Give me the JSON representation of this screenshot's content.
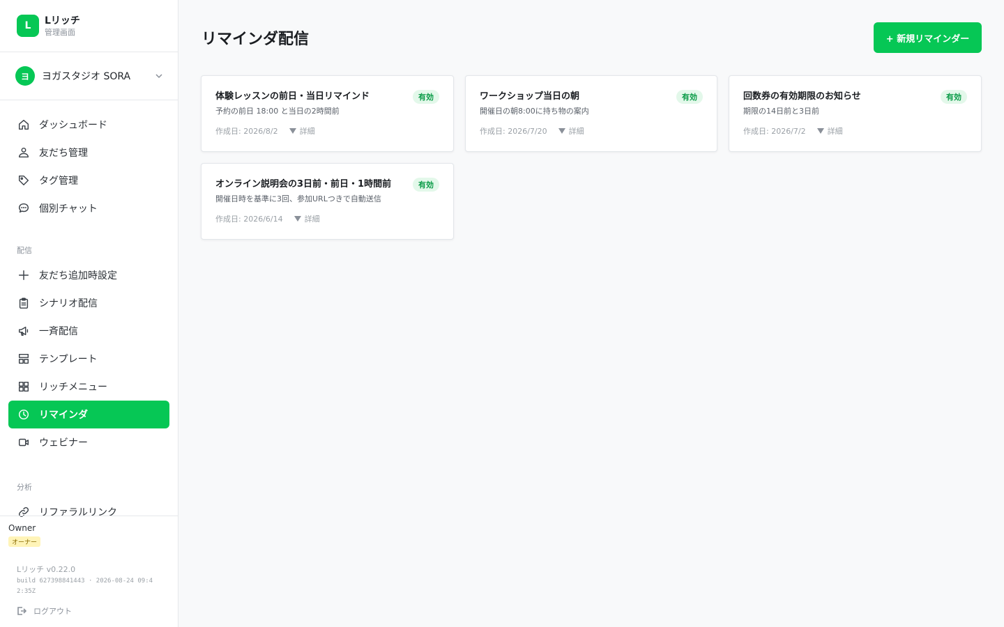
{
  "brand": {
    "logo": "L",
    "name": "Lリッチ",
    "subtitle": "管理画面",
    "color": "#06c755"
  },
  "account": {
    "avatar": "ヨ",
    "name": "ヨガスタジオ SORA",
    "icon": "chevron-down-icon"
  },
  "nav": {
    "main": [
      {
        "label": "ダッシュボード",
        "icon": "home-icon"
      },
      {
        "label": "友だち管理",
        "icon": "users-icon"
      },
      {
        "label": "タグ管理",
        "icon": "tag-icon"
      },
      {
        "label": "個別チャット",
        "icon": "chat-icon"
      }
    ],
    "section_delivery": "配信",
    "delivery": [
      {
        "label": "友だち追加時設定",
        "icon": "plus-icon"
      },
      {
        "label": "シナリオ配信",
        "icon": "clipboard-icon"
      },
      {
        "label": "一斉配信",
        "icon": "megaphone-icon"
      },
      {
        "label": "テンプレート",
        "icon": "template-icon"
      },
      {
        "label": "リッチメニュー",
        "icon": "grid-icon"
      },
      {
        "label": "リマインダ",
        "icon": "clock-icon",
        "active": true
      },
      {
        "label": "ウェビナー",
        "icon": "video-icon"
      }
    ],
    "section_analytics": "分析",
    "analytics": [
      {
        "label": "リファラルリンク",
        "icon": "link-icon"
      }
    ]
  },
  "footer": {
    "user": "Owner",
    "role": "オーナー",
    "version": "Lリッチ v0.22.0",
    "build": "build 627398841443 · 2026-08-24 09:42:35Z",
    "logout": "ログアウト"
  },
  "page": {
    "title": "リマインダ配信",
    "new_button": "+ 新規リマインダー"
  },
  "reminders": [
    {
      "title": "体験レッスンの前日・当日リマインド",
      "status": "有効",
      "description": "予約の前日 18:00 と当日の2時間前",
      "created": "作成日: 2026/8/2",
      "detail": "詳細"
    },
    {
      "title": "ワークショップ当日の朝",
      "status": "有効",
      "description": "開催日の朝8:00に持ち物の案内",
      "created": "作成日: 2026/7/20",
      "detail": "詳細"
    },
    {
      "title": "回数券の有効期限のお知らせ",
      "status": "有効",
      "description": "期限の14日前と3日前",
      "created": "作成日: 2026/7/2",
      "detail": "詳細"
    },
    {
      "title": "オンライン説明会の3日前・前日・1時間前",
      "status": "有効",
      "description": "開催日時を基準に3回、参加URLつきで自動送信",
      "created": "作成日: 2026/6/14",
      "detail": "詳細"
    }
  ]
}
